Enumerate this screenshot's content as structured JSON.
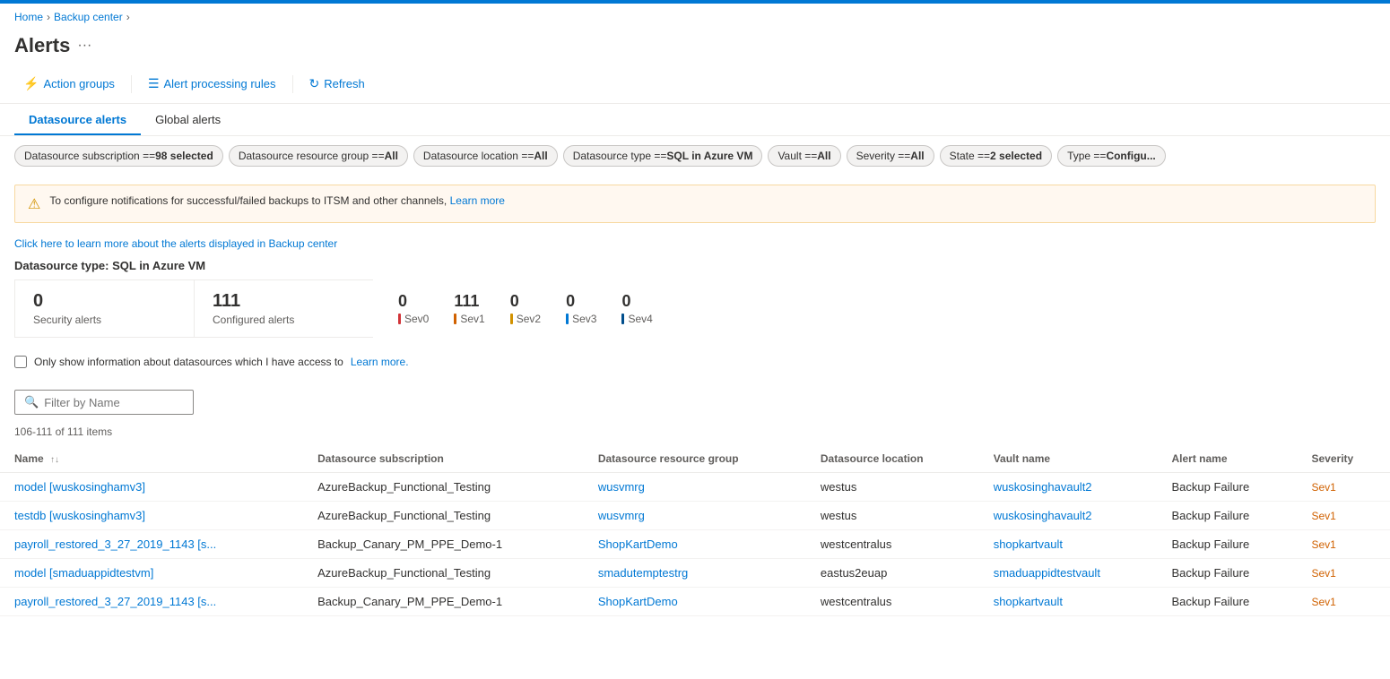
{
  "topBar": {},
  "breadcrumb": {
    "items": [
      "Home",
      "Backup center"
    ]
  },
  "pageHeader": {
    "title": "Alerts",
    "menuDots": "···"
  },
  "toolbar": {
    "buttons": [
      {
        "id": "action-groups",
        "label": "Action groups",
        "icon": "⚡"
      },
      {
        "id": "alert-processing-rules",
        "label": "Alert processing rules",
        "icon": "☰"
      },
      {
        "id": "refresh",
        "label": "Refresh",
        "icon": "↻"
      }
    ]
  },
  "tabs": [
    {
      "id": "datasource-alerts",
      "label": "Datasource alerts",
      "active": true
    },
    {
      "id": "global-alerts",
      "label": "Global alerts",
      "active": false
    }
  ],
  "filters": [
    {
      "id": "subscription",
      "text": "Datasource subscription == ",
      "value": "98 selected"
    },
    {
      "id": "resource-group",
      "text": "Datasource resource group == ",
      "value": "All"
    },
    {
      "id": "location",
      "text": "Datasource location == ",
      "value": "All"
    },
    {
      "id": "type",
      "text": "Datasource type == ",
      "value": "SQL in Azure VM"
    },
    {
      "id": "vault",
      "text": "Vault == ",
      "value": "All"
    },
    {
      "id": "severity",
      "text": "Severity == ",
      "value": "All"
    },
    {
      "id": "state",
      "text": "State == ",
      "value": "2 selected"
    },
    {
      "id": "alert-type",
      "text": "Type == ",
      "value": "Configu..."
    }
  ],
  "warningBanner": {
    "text": "To configure notifications for successful/failed backups to ITSM and other channels,",
    "linkText": "Learn more",
    "linkUrl": "#"
  },
  "infoLink": {
    "text": "Click here to learn more about the alerts displayed in Backup center"
  },
  "datasourceType": {
    "label": "Datasource type: SQL in Azure VM"
  },
  "metrics": {
    "securityAlerts": {
      "count": "0",
      "label": "Security alerts"
    },
    "configuredAlerts": {
      "count": "111",
      "label": "Configured alerts"
    },
    "severities": [
      {
        "id": "sev0",
        "count": "0",
        "label": "Sev0",
        "colorClass": "sev0-bar"
      },
      {
        "id": "sev1",
        "count": "111",
        "label": "Sev1",
        "colorClass": "sev1-bar"
      },
      {
        "id": "sev2",
        "count": "0",
        "label": "Sev2",
        "colorClass": "sev2-bar"
      },
      {
        "id": "sev3",
        "count": "0",
        "label": "Sev3",
        "colorClass": "sev3-bar"
      },
      {
        "id": "sev4",
        "count": "0",
        "label": "Sev4",
        "colorClass": "sev4-bar"
      }
    ]
  },
  "checkboxRow": {
    "label": "Only show information about datasources which I have access to",
    "linkText": "Learn more.",
    "linkUrl": "#"
  },
  "filterInput": {
    "placeholder": "Filter by Name"
  },
  "itemsCount": {
    "text": "106-111 of 111 items"
  },
  "tableColumns": [
    {
      "id": "name",
      "label": "Name",
      "sortable": true
    },
    {
      "id": "subscription",
      "label": "Datasource subscription",
      "sortable": false
    },
    {
      "id": "resource-group",
      "label": "Datasource resource group",
      "sortable": false
    },
    {
      "id": "location",
      "label": "Datasource location",
      "sortable": false
    },
    {
      "id": "vault-name",
      "label": "Vault name",
      "sortable": false
    },
    {
      "id": "alert-name",
      "label": "Alert name",
      "sortable": false
    },
    {
      "id": "severity",
      "label": "Severity",
      "sortable": false
    }
  ],
  "tableRows": [
    {
      "name": "model [wuskosinghamv3]",
      "subscription": "AzureBackup_Functional_Testing",
      "resourceGroup": "wusvmrg",
      "location": "westus",
      "vaultName": "wuskosinghavault2",
      "alertName": "Backup Failure",
      "severity": "Sev1"
    },
    {
      "name": "testdb [wuskosinghamv3]",
      "subscription": "AzureBackup_Functional_Testing",
      "resourceGroup": "wusvmrg",
      "location": "westus",
      "vaultName": "wuskosinghavault2",
      "alertName": "Backup Failure",
      "severity": "Sev1"
    },
    {
      "name": "payroll_restored_3_27_2019_1143 [s...",
      "subscription": "Backup_Canary_PM_PPE_Demo-1",
      "resourceGroup": "ShopKartDemo",
      "location": "westcentralus",
      "vaultName": "shopkartvault",
      "alertName": "Backup Failure",
      "severity": "Sev1"
    },
    {
      "name": "model [smaduappidtestvm]",
      "subscription": "AzureBackup_Functional_Testing",
      "resourceGroup": "smadutemptestrg",
      "location": "eastus2euap",
      "vaultName": "smaduappidtestvault",
      "alertName": "Backup Failure",
      "severity": "Sev1"
    },
    {
      "name": "payroll_restored_3_27_2019_1143 [s...",
      "subscription": "Backup_Canary_PM_PPE_Demo-1",
      "resourceGroup": "ShopKartDemo",
      "location": "westcentralus",
      "vaultName": "shopkartvault",
      "alertName": "Backup Failure",
      "severity": "Sev1"
    }
  ]
}
